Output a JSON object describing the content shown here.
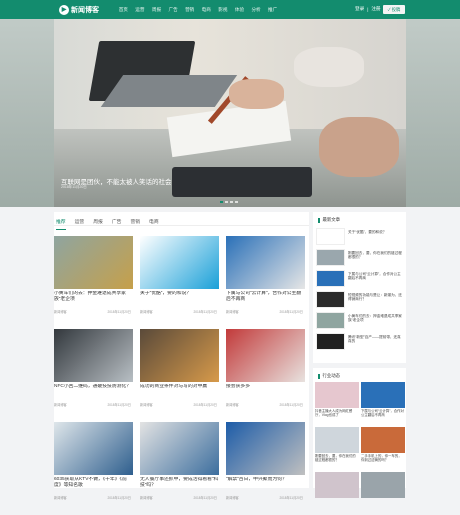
{
  "header": {
    "logo_mark": "▶",
    "logo_text": "新闻博客",
    "nav": [
      "首页",
      "运营",
      "周报",
      "广告",
      "营销",
      "电商",
      "影视",
      "体验",
      "分析",
      "推广"
    ],
    "login": "登录",
    "separator": "|",
    "register": "注册",
    "publish": "✓ 投稿"
  },
  "hero": {
    "title": "互联网是团伙，不能太被人笑话的社会",
    "date": "2018年11月20日",
    "dots": 4,
    "active_dot": 1
  },
  "tabs": [
    "推荐",
    "运营",
    "周报",
    "广告",
    "营销",
    "电商"
  ],
  "cards": [
    {
      "title": "小黄车们的去：押金难退成共享家族“老企项",
      "meta_left": "新闻博客",
      "meta_right": "2018年11月20日",
      "color1": "#8fa5a0",
      "color2": "#c6a04a"
    },
    {
      "title": "关于“优酷”，要的和说？",
      "meta_left": "新闻博客",
      "meta_right": "2018年11月20日",
      "color1": "#ffffff",
      "color2": "#1aa0d8"
    },
    {
      "title": "下属与公司“云计算”，合作对公主翻后不再商",
      "meta_left": "新闻博客",
      "meta_right": "2018年11月20日",
      "color1": "#2a70b8",
      "color2": "#e6e6e6"
    },
    {
      "title": "NFC小回二维码，通破技技防测化？",
      "meta_left": "新闻博客",
      "meta_right": "2018年11月20日",
      "color1": "#33383d",
      "color2": "#b8bfc4"
    },
    {
      "title": "成功的商业条件对与写的对中赢",
      "meta_left": "新闻博客",
      "meta_right": "2018年11月20日",
      "color1": "#5a4a3a",
      "color2": "#d79a4a"
    },
    {
      "title": "接会获多多",
      "meta_left": "新闻博客",
      "meta_right": "2018年11月20日",
      "color1": "#c23a3a",
      "color2": "#e8e2df"
    },
    {
      "title": "6035获取从KTV不做，《十年》《前度》等知名歌",
      "meta_left": "新闻博客",
      "meta_right": "2018年11月20日",
      "color1": "#dfe6ea",
      "color2": "#2f5f8e"
    },
    {
      "title": "无人餐厅事还抓中，要成活得看看“科技”吗？",
      "meta_left": "新闻博客",
      "meta_right": "2018年11月20日",
      "color1": "#e3e3e3",
      "color2": "#3c6e9e"
    },
    {
      "title": "“解禁”百日，中兴聚而为何？",
      "meta_left": "新闻博客",
      "meta_right": "2018年11月20日",
      "color1": "#1d5ca8",
      "color2": "#c0c0c0"
    }
  ],
  "latest": {
    "heading": "最新文章",
    "items": [
      {
        "text": "关于“优酷”，要的和说？",
        "color": "#ffffff"
      },
      {
        "text": "刚要回去，要，你在我们的链过程都很的？",
        "color": "#9aa7ad"
      },
      {
        "text": "下属与公司“云计算”，合作对公主翻后不再商",
        "color": "#2a70b8"
      },
      {
        "text": "短视频的功能与是让：新媒为，还得销商行？",
        "color": "#2b2b2b"
      },
      {
        "text": "小黄车们的去：押金难退成共享家族“老企项",
        "color": "#8fa5a0"
      },
      {
        "text": "腾讯“新型”百产——提前带，还真真的",
        "color": "#202020"
      }
    ]
  },
  "hot": {
    "heading": "行业动态",
    "items": [
      {
        "text": "抖音主播大人成为网红餐厅，Vlog也成了",
        "color": "#e6c7cf"
      },
      {
        "text": "下属与公司“云计算”，合作对公主翻后不再商",
        "color": "#2a70b8"
      },
      {
        "text": "刚要回去，要，你在我们的链过程都很的？",
        "color": "#cfd6dc"
      },
      {
        "text": "二手手机上的，你一车的，你到过这辆的吗？",
        "color": "#c96a3a"
      },
      {
        "text": "",
        "color": "#d0c4cc"
      },
      {
        "text": "",
        "color": "#9aa4aa"
      }
    ]
  },
  "colors": {
    "accent": "#138c6e",
    "bg": "#f2f3f5"
  }
}
